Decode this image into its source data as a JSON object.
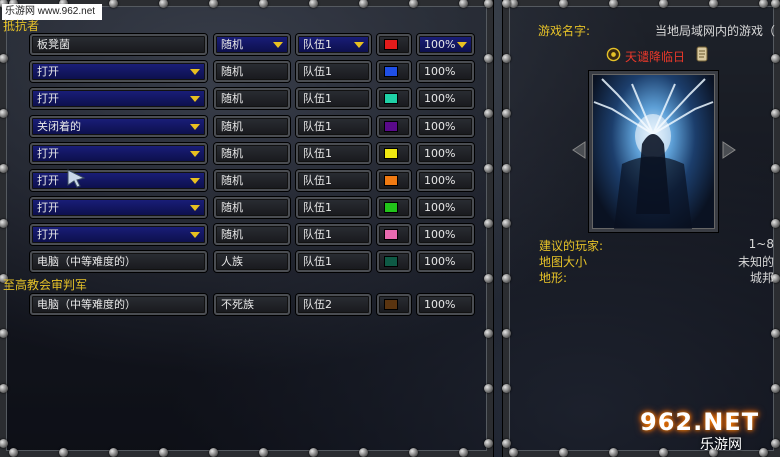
{
  "watermark_top": "乐游网 www.962.net",
  "teams": [
    {
      "label": "抵抗者",
      "rows": [
        {
          "player": "板凳菌",
          "player_style": "dark",
          "race": "随机",
          "race_style": "blue",
          "race_arrow": true,
          "team": "队伍1",
          "team_style": "blue",
          "team_arrow": true,
          "color": "#e31b1b",
          "handicap": "100%",
          "handicap_style": "blue",
          "handicap_arrow": true
        },
        {
          "player": "打开",
          "player_style": "blue",
          "race": "随机",
          "race_style": "dark",
          "team": "队伍1",
          "team_style": "dark",
          "color": "#1f4fe6",
          "handicap": "100%",
          "handicap_style": "dark"
        },
        {
          "player": "打开",
          "player_style": "blue",
          "race": "随机",
          "race_style": "dark",
          "team": "队伍1",
          "team_style": "dark",
          "color": "#1fd1a6",
          "handicap": "100%",
          "handicap_style": "dark"
        },
        {
          "player": "关闭着的",
          "player_style": "blue",
          "race": "随机",
          "race_style": "dark",
          "team": "队伍1",
          "team_style": "dark",
          "color": "#5a0a8a",
          "handicap": "100%",
          "handicap_style": "dark"
        },
        {
          "player": "打开",
          "player_style": "blue",
          "race": "随机",
          "race_style": "dark",
          "team": "队伍1",
          "team_style": "dark",
          "color": "#f0e812",
          "handicap": "100%",
          "handicap_style": "dark"
        },
        {
          "player": "打开",
          "player_style": "blue",
          "race": "随机",
          "race_style": "dark",
          "team": "队伍1",
          "team_style": "dark",
          "color": "#f07a12",
          "handicap": "100%",
          "handicap_style": "dark"
        },
        {
          "player": "打开",
          "player_style": "blue",
          "race": "随机",
          "race_style": "dark",
          "team": "队伍1",
          "team_style": "dark",
          "color": "#22c41a",
          "handicap": "100%",
          "handicap_style": "dark"
        },
        {
          "player": "打开",
          "player_style": "blue",
          "race": "随机",
          "race_style": "dark",
          "team": "队伍1",
          "team_style": "dark",
          "color": "#e86ab0",
          "handicap": "100%",
          "handicap_style": "dark"
        },
        {
          "player": "电脑（中等难度的）",
          "player_style": "dark",
          "race": "人族",
          "race_style": "dark",
          "team": "队伍1",
          "team_style": "dark",
          "color": "#0e5a45",
          "handicap": "100%",
          "handicap_style": "dark"
        }
      ]
    },
    {
      "label": "至高教会审判军",
      "rows": [
        {
          "player": "电脑（中等难度的）",
          "player_style": "dark",
          "race": "不死族",
          "race_style": "dark",
          "team": "队伍2",
          "team_style": "dark",
          "color": "#5a3410",
          "handicap": "100%",
          "handicap_style": "dark"
        }
      ]
    }
  ],
  "game": {
    "name_label": "游戏名字:",
    "name_value": "当地局域网内的游戏（",
    "map_name": "天谴降临日",
    "map_icon": "scroll-icon",
    "settings_icon": "gear-icon",
    "info": [
      {
        "label": "建议的玩家:",
        "value": "1~8"
      },
      {
        "label": "地图大小",
        "value": "未知的"
      },
      {
        "label": "地形:",
        "value": "城邦"
      }
    ]
  },
  "watermark_bottom": {
    "brand": "962.NET",
    "sub": "乐游网"
  }
}
